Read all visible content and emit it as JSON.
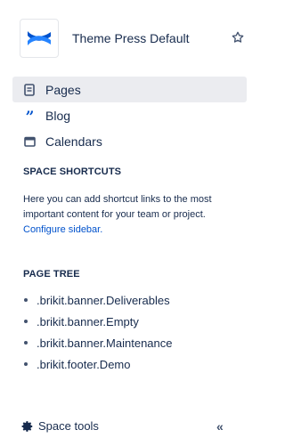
{
  "space": {
    "name": "Theme Press Default",
    "logo_icon": "confluence-logo-icon",
    "star_icon": "star-outline-icon"
  },
  "nav": {
    "items": [
      {
        "label": "Pages",
        "icon": "page-icon",
        "active": true
      },
      {
        "label": "Blog",
        "icon": "blog-quote-icon",
        "active": false
      },
      {
        "label": "Calendars",
        "icon": "calendar-icon",
        "active": false
      }
    ]
  },
  "shortcuts": {
    "title": "SPACE SHORTCUTS",
    "text": "Here you can add shortcut links to the most important content for your team or project.",
    "link": "Configure sidebar."
  },
  "page_tree": {
    "title": "PAGE TREE",
    "items": [
      ".brikit.banner.Deliverables",
      ".brikit.banner.Empty",
      ".brikit.banner.Maintenance",
      ".brikit.footer.Demo"
    ]
  },
  "footer": {
    "space_tools_label": "Space tools",
    "collapse_label": "«"
  },
  "colors": {
    "brand_blue": "#0052cc",
    "active_bg": "#ebecf0",
    "text": "#172b4d"
  }
}
